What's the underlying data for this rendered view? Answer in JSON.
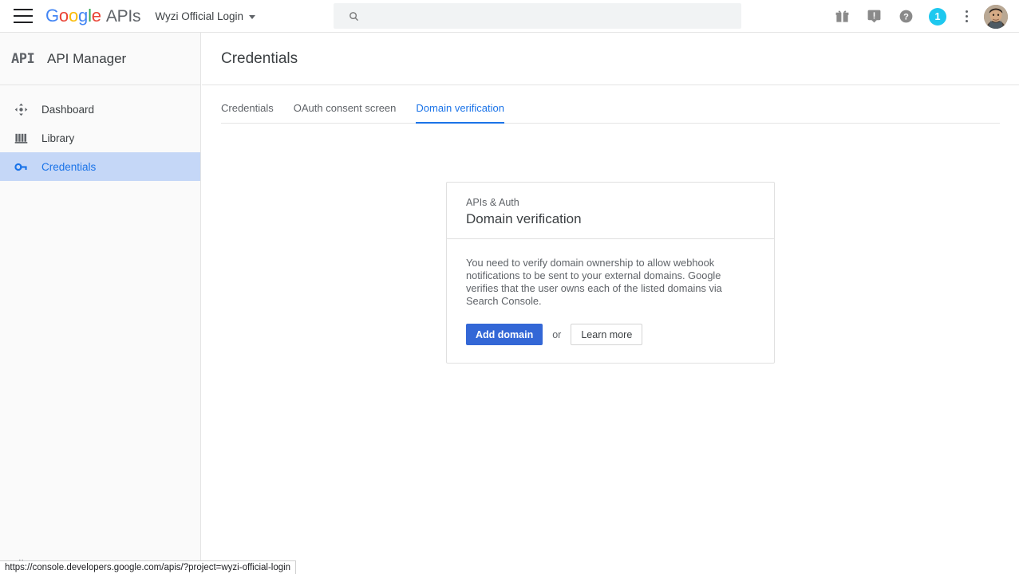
{
  "topbar": {
    "menu_label": "Main menu",
    "logo": {
      "g": "G",
      "o1": "o",
      "o2": "o",
      "g2": "g",
      "l": "l",
      "e": "e",
      "apis": "APIs"
    },
    "project": {
      "name": "Wyzi Official Login"
    },
    "search": {
      "value": "",
      "placeholder": ""
    },
    "icons": {
      "gift": "gift-icon",
      "feedback": "feedback-icon",
      "help": "help-icon",
      "notifications_count": "1",
      "more": "more-vert-icon",
      "account": "account-avatar"
    },
    "colors": {
      "badge": "#1ec8ef",
      "accent": "#1a73e8"
    }
  },
  "sidebar": {
    "logo_text": "API",
    "title": "API Manager",
    "items": [
      {
        "label": "Dashboard",
        "icon": "dashboard-icon",
        "active": false
      },
      {
        "label": "Library",
        "icon": "library-icon",
        "active": false
      },
      {
        "label": "Credentials",
        "icon": "key-icon",
        "active": true
      }
    ],
    "collapse_label": "◁|"
  },
  "content": {
    "page_title": "Credentials",
    "tabs": [
      {
        "label": "Credentials",
        "active": false
      },
      {
        "label": "OAuth consent screen",
        "active": false
      },
      {
        "label": "Domain verification",
        "active": true
      }
    ]
  },
  "card": {
    "eyebrow": "APIs & Auth",
    "title": "Domain verification",
    "body_text": "You need to verify domain ownership to allow webhook notifications to be sent to your external domains. Google verifies that the user owns each of the listed domains via Search Console.",
    "primary_button": "Add domain",
    "or_label": "or",
    "secondary_button": "Learn more"
  },
  "statusbar": {
    "url": "https://console.developers.google.com/apis/?project=wyzi-official-login"
  }
}
